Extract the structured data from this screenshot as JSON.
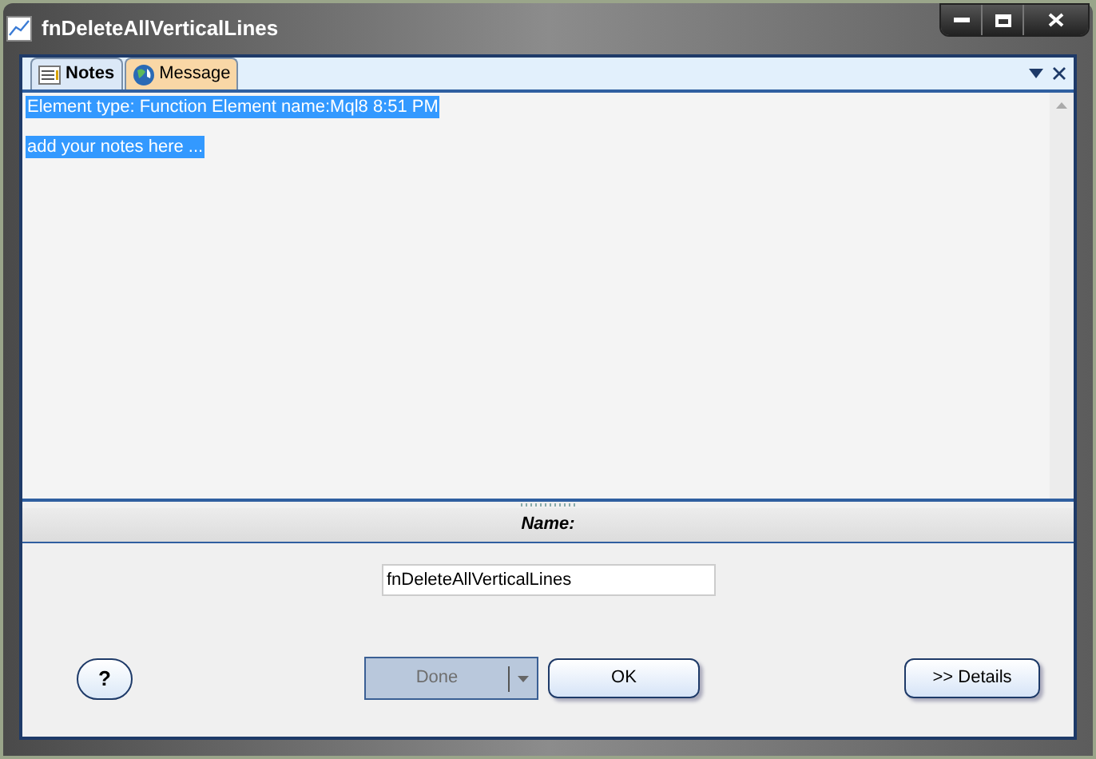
{
  "window": {
    "title": "fnDeleteAllVerticalLines"
  },
  "tabs": [
    {
      "label": "Notes",
      "selected": true,
      "kind": "notes"
    },
    {
      "label": "Message",
      "selected": false,
      "kind": "message"
    }
  ],
  "notes": {
    "lines": [
      "Element type: Function Element name:Mql8 8:51 PM",
      "add your notes here ..."
    ]
  },
  "name_section": {
    "header": "Name:",
    "value": "fnDeleteAllVerticalLines"
  },
  "buttons": {
    "help": "?",
    "done": {
      "label": "Done",
      "disabled": true
    },
    "ok": "OK",
    "details": ">> Details"
  }
}
